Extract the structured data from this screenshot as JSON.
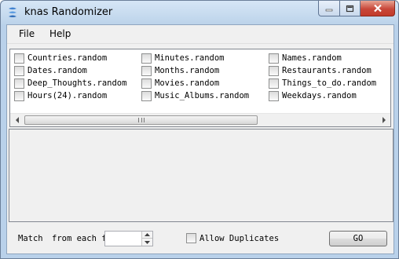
{
  "window": {
    "title": "knas Randomizer",
    "icon": "app-logo-icon"
  },
  "menu": {
    "items": [
      {
        "label": "File"
      },
      {
        "label": "Help"
      }
    ]
  },
  "files": {
    "columns": [
      [
        "Countries.random",
        "Dates.random",
        "Deep_Thoughts.random",
        "Hours(24).random"
      ],
      [
        "Minutes.random",
        "Months.random",
        "Movies.random",
        "Music_Albums.random"
      ],
      [
        "Names.random",
        "Restaurants.random",
        "Things_to_do.random",
        "Weekdays.random"
      ]
    ],
    "checked": false
  },
  "bottom": {
    "match_label": "Match",
    "from_label": "from each file",
    "count_value": "",
    "allow_label": "Allow Duplicates",
    "allow_checked": false,
    "go_label": "GO"
  }
}
